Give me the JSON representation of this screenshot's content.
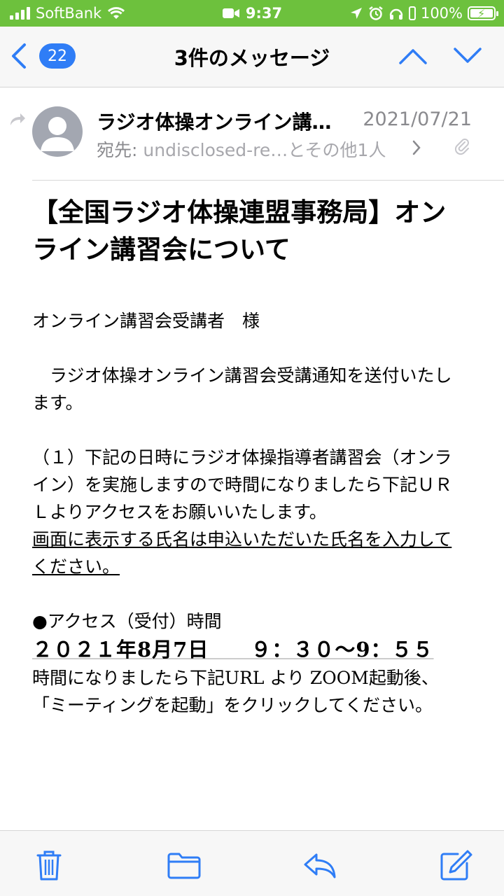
{
  "status_bar": {
    "carrier": "SoftBank",
    "time": "9:37",
    "battery": "100%"
  },
  "nav": {
    "back_badge": "22",
    "title": "3件のメッセージ"
  },
  "message": {
    "sender": "ラジオ体操オンライン講…",
    "date": "2021/07/21",
    "recipient_label": "宛先:",
    "recipient_value": "undisclosed-re…とその他1人",
    "subject": "【全国ラジオ体操連盟事務局】オンライン講習会について",
    "body": {
      "greeting": "オンライン講習会受講者　様",
      "intro": "　ラジオ体操オンライン講習会受講通知を送付いたします。",
      "item1": "（１）下記の日時にラジオ体操指導者講習会（オンライン）を実施しますので時間になりましたら下記ＵＲＬよりアクセスをお願いいたします。",
      "item1_note": "画面に表示する氏名は申込いただいた氏名を入力してください。",
      "access_label": "●アクセス（受付）時間",
      "access_time": "２０２１年8月7日　　９：３０〜9：５５",
      "instruction": "時間になりましたら下記URL より ZOOM起動後、「ミーティングを起動」をクリックしてください。"
    }
  },
  "icons": {
    "trash": "trash-icon",
    "folder": "folder-icon",
    "reply": "reply-icon",
    "compose": "compose-icon"
  },
  "colors": {
    "status_bar": "#6dc13d",
    "accent": "#2f7df6",
    "muted": "#8a8a8e"
  }
}
